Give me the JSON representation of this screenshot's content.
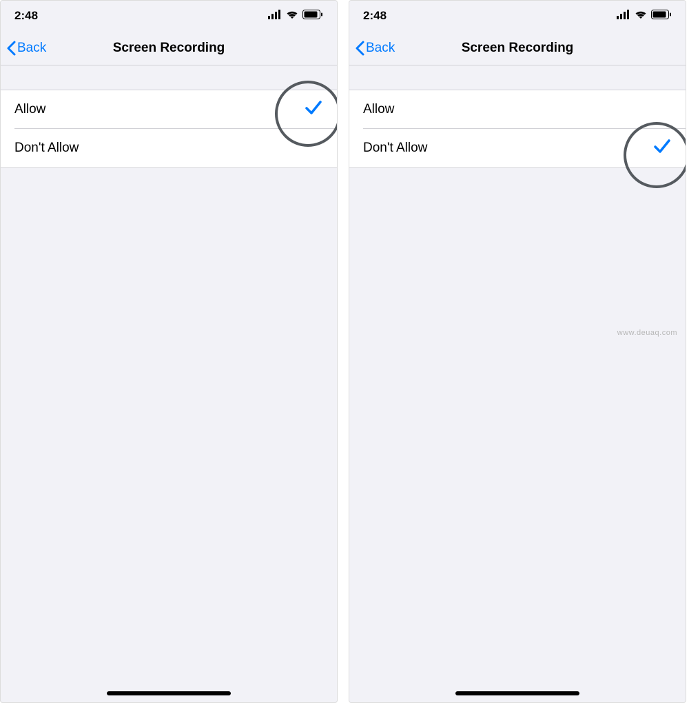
{
  "screens": [
    {
      "status": {
        "time": "2:48"
      },
      "nav": {
        "back": "Back",
        "title": "Screen Recording"
      },
      "options": [
        {
          "label": "Allow",
          "selected": true
        },
        {
          "label": "Don't Allow",
          "selected": false
        }
      ],
      "highlight_index": 0
    },
    {
      "status": {
        "time": "2:48"
      },
      "nav": {
        "back": "Back",
        "title": "Screen Recording"
      },
      "options": [
        {
          "label": "Allow",
          "selected": false
        },
        {
          "label": "Don't Allow",
          "selected": true
        }
      ],
      "highlight_index": 1
    }
  ],
  "watermark": "www.deuaq.com"
}
